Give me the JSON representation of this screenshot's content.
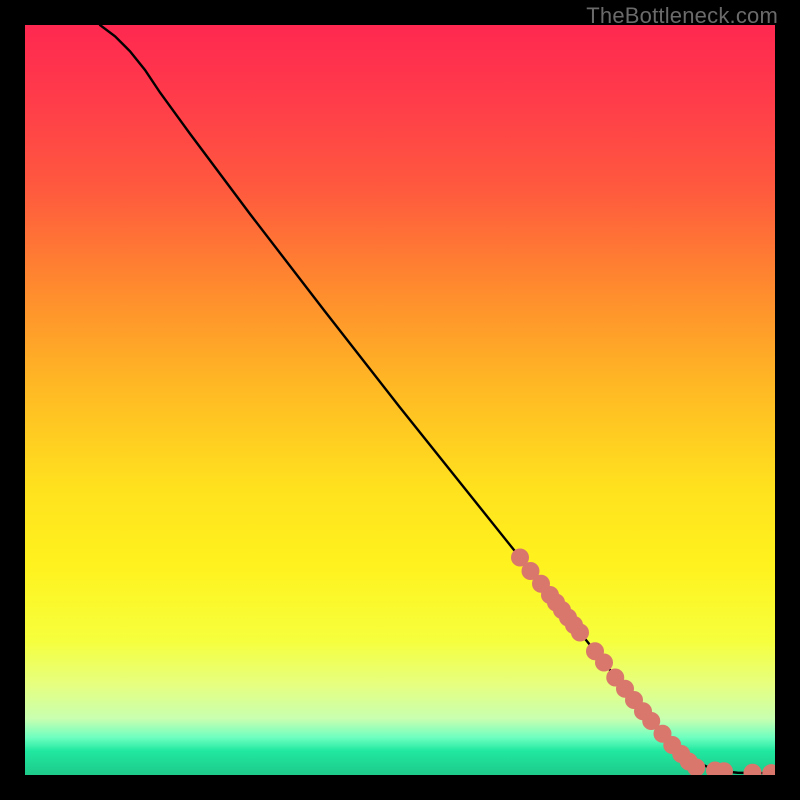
{
  "attribution": "TheBottleneck.com",
  "colors": {
    "frame": "#000000",
    "line": "#000000",
    "marker_fill": "#d9776d",
    "marker_stroke": "#b76058",
    "gradient_top": "#ff2850",
    "gradient_bottom": "#1eca8a"
  },
  "chart_data": {
    "type": "line",
    "title": "",
    "xlabel": "",
    "ylabel": "",
    "xlim": [
      0,
      100
    ],
    "ylim": [
      0,
      100
    ],
    "grid": false,
    "legend": false,
    "series": [
      {
        "name": "curve",
        "x": [
          10,
          12,
          14,
          16,
          18,
          22,
          30,
          40,
          50,
          60,
          66,
          72,
          78,
          82,
          84,
          86,
          88,
          92,
          95,
          99.5
        ],
        "y": [
          100,
          98.5,
          96.5,
          94,
          91,
          85.5,
          74.8,
          61.8,
          49,
          36.5,
          29,
          21.5,
          14,
          9,
          6.6,
          4.5,
          2.5,
          0.6,
          0.3,
          0.25
        ]
      }
    ],
    "markers": [
      {
        "x": 66.0,
        "y": 29.0
      },
      {
        "x": 67.4,
        "y": 27.2
      },
      {
        "x": 68.8,
        "y": 25.5
      },
      {
        "x": 70.0,
        "y": 24.0
      },
      {
        "x": 70.8,
        "y": 23.0
      },
      {
        "x": 71.6,
        "y": 22.0
      },
      {
        "x": 72.4,
        "y": 21.0
      },
      {
        "x": 73.2,
        "y": 20.0
      },
      {
        "x": 74.0,
        "y": 19.0
      },
      {
        "x": 76.0,
        "y": 16.5
      },
      {
        "x": 77.2,
        "y": 15.0
      },
      {
        "x": 78.7,
        "y": 13.0
      },
      {
        "x": 80.0,
        "y": 11.5
      },
      {
        "x": 81.2,
        "y": 10.0
      },
      {
        "x": 82.4,
        "y": 8.5
      },
      {
        "x": 83.5,
        "y": 7.2
      },
      {
        "x": 85.0,
        "y": 5.5
      },
      {
        "x": 86.3,
        "y": 4.0
      },
      {
        "x": 87.5,
        "y": 2.8
      },
      {
        "x": 88.5,
        "y": 1.8
      },
      {
        "x": 89.5,
        "y": 1.0
      },
      {
        "x": 92.0,
        "y": 0.6
      },
      {
        "x": 93.2,
        "y": 0.5
      },
      {
        "x": 97.0,
        "y": 0.3
      },
      {
        "x": 99.5,
        "y": 0.25
      }
    ]
  }
}
